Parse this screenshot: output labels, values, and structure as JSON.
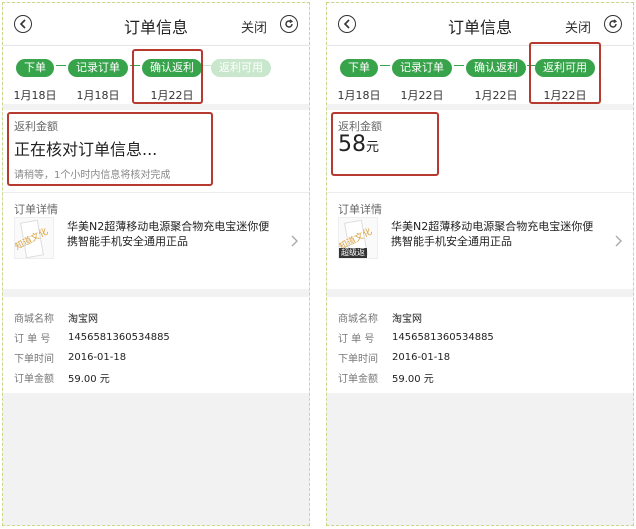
{
  "panels": [
    {
      "header": {
        "title": "订单信息",
        "close_label": "关闭"
      },
      "steps": [
        {
          "label": "下单",
          "date": "1月18日",
          "active": true
        },
        {
          "label": "记录订单",
          "date": "1月18日",
          "active": true
        },
        {
          "label": "确认返利",
          "date": "1月22日",
          "active": true
        },
        {
          "label": "返利可用",
          "date": "",
          "active": false
        }
      ],
      "rebate": {
        "label": "返利金额",
        "status": "正在核对订单信息...",
        "note": "请稍等，1个小时内信息将核对完成"
      },
      "detail": {
        "label": "订单详情",
        "product_name": "华美N2超薄移动电源聚合物充电宝迷你便携智能手机安全通用正品",
        "watermark": "知道文化",
        "thumb_badge": ""
      },
      "info": [
        {
          "label": "商城名称",
          "value": "淘宝网"
        },
        {
          "label": "订 单 号",
          "value": "1456581360534885"
        },
        {
          "label": "下单时间",
          "value": "2016-01-18"
        },
        {
          "label": "订单金额",
          "value": "59.00 元"
        }
      ]
    },
    {
      "header": {
        "title": "订单信息",
        "close_label": "关闭"
      },
      "steps": [
        {
          "label": "下单",
          "date": "1月18日",
          "active": true
        },
        {
          "label": "记录订单",
          "date": "1月22日",
          "active": true
        },
        {
          "label": "确认返利",
          "date": "1月22日",
          "active": true
        },
        {
          "label": "返利可用",
          "date": "1月22日",
          "active": true
        }
      ],
      "rebate": {
        "label": "返利金额",
        "amount": "58",
        "unit": "元"
      },
      "detail": {
        "label": "订单详情",
        "product_name": "华美N2超薄移动电源聚合物充电宝迷你便携智能手机安全通用正品",
        "watermark": "知道文化",
        "thumb_badge": "超级返"
      },
      "info": [
        {
          "label": "商城名称",
          "value": "淘宝网"
        },
        {
          "label": "订 单 号",
          "value": "1456581360534885"
        },
        {
          "label": "下单时间",
          "value": "2016-01-18"
        },
        {
          "label": "订单金额",
          "value": "59.00 元"
        }
      ]
    }
  ],
  "colors": {
    "accent_green": "#37a34a",
    "inactive_green": "#c9e7cc",
    "highlight_red": "#b73a30"
  }
}
